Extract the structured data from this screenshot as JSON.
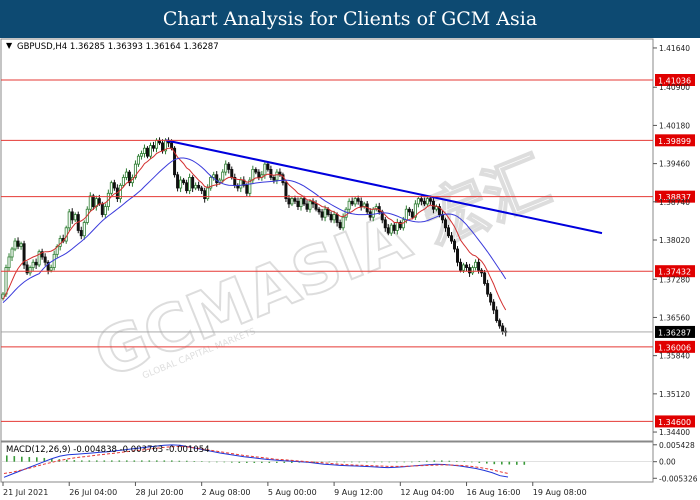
{
  "banner_title": "Chart Analysis for Clients of GCM Asia",
  "watermark": "GCMASIA 宏汇",
  "watermark_sub": "GLOBAL CAPITAL MARKETS",
  "colors": {
    "banner": "#0d4a72",
    "candle_up": "#2e7d32",
    "candle_down": "#111111",
    "sma_fast": "#d32f2f",
    "sma_slow": "#3a3adb",
    "trendline": "#0000dd",
    "level_line": "#e53935",
    "level_label_bg": "#e00000",
    "current_label_bg": "#000000",
    "macd_line": "#1f35d8",
    "signal_line": "#e53935",
    "histogram": "#3a9a3a"
  },
  "chart_data": [
    {
      "type": "candlestick",
      "symbol": "GBPUSD,H4",
      "ohlc_header": "GBPUSD,H4  1.36285 1.36393 1.36164 1.36287",
      "ohlc": {
        "open": 1.36285,
        "high": 1.36393,
        "low": 1.36164,
        "close": 1.36287
      },
      "ylim": [
        1.3425,
        1.4179
      ],
      "y_ticks": [
        "1.41640",
        "1.40900",
        "1.40180",
        "1.39460",
        "1.38740",
        "1.38020",
        "1.37280",
        "1.36560",
        "1.35840",
        "1.35120",
        "1.34400"
      ],
      "x_tick_labels": [
        "21 Jul 2021",
        "26 Jul 04:00",
        "28 Jul 20:00",
        "2 Aug 08:00",
        "5 Aug 00:00",
        "9 Aug 12:00",
        "12 Aug 04:00",
        "16 Aug 16:00",
        "19 Aug 08:00"
      ],
      "x_tick_index": [
        0,
        22,
        44,
        66,
        88,
        110,
        132,
        154,
        176
      ],
      "levels": [
        {
          "value": 1.41036,
          "label": "1.41036"
        },
        {
          "value": 1.39899,
          "label": "1.39899"
        },
        {
          "value": 1.38837,
          "label": "1.38837"
        },
        {
          "value": 1.37432,
          "label": "1.37432"
        },
        {
          "value": 1.36006,
          "label": "1.36006"
        },
        {
          "value": 1.346,
          "label": "1.34600"
        }
      ],
      "current_price": {
        "value": 1.36287,
        "label": "1.36287"
      },
      "trendline": [
        {
          "i": 54,
          "y": 1.399
        },
        {
          "i": 199,
          "y": 1.3815
        }
      ],
      "closes": [
        1.37,
        1.375,
        1.377,
        1.3785,
        1.38,
        1.379,
        1.3795,
        1.3755,
        1.374,
        1.375,
        1.376,
        1.3755,
        1.378,
        1.377,
        1.376,
        1.3745,
        1.375,
        1.3775,
        1.379,
        1.3805,
        1.38,
        1.3825,
        1.3855,
        1.384,
        1.385,
        1.382,
        1.381,
        1.3835,
        1.386,
        1.3885,
        1.3865,
        1.388,
        1.387,
        1.385,
        1.3865,
        1.389,
        1.391,
        1.39,
        1.388,
        1.3905,
        1.392,
        1.393,
        1.391,
        1.392,
        1.3945,
        1.396,
        1.3965,
        1.3975,
        1.396,
        1.398,
        1.3975,
        1.399,
        1.3985,
        1.397,
        1.399,
        1.3985,
        1.3975,
        1.3925,
        1.39,
        1.3915,
        1.391,
        1.3895,
        1.392,
        1.39,
        1.3905,
        1.39,
        1.3895,
        1.388,
        1.39,
        1.392,
        1.3925,
        1.391,
        1.3915,
        1.393,
        1.3945,
        1.3935,
        1.392,
        1.3905,
        1.39,
        1.3915,
        1.3905,
        1.389,
        1.3915,
        1.3935,
        1.393,
        1.392,
        1.3925,
        1.3945,
        1.3935,
        1.392,
        1.3915,
        1.393,
        1.3925,
        1.391,
        1.388,
        1.387,
        1.388,
        1.3875,
        1.3865,
        1.388,
        1.387,
        1.386,
        1.3875,
        1.387,
        1.386,
        1.3855,
        1.3845,
        1.386,
        1.385,
        1.384,
        1.385,
        1.3835,
        1.3825,
        1.3845,
        1.386,
        1.3875,
        1.387,
        1.388,
        1.3875,
        1.3865,
        1.387,
        1.3855,
        1.3845,
        1.386,
        1.3865,
        1.3855,
        1.384,
        1.3825,
        1.3815,
        1.383,
        1.382,
        1.3835,
        1.3825,
        1.384,
        1.386,
        1.3855,
        1.3845,
        1.387,
        1.388,
        1.3875,
        1.387,
        1.388,
        1.3875,
        1.386,
        1.3865,
        1.385,
        1.384,
        1.3825,
        1.381,
        1.38,
        1.3785,
        1.376,
        1.3745,
        1.3755,
        1.375,
        1.374,
        1.375,
        1.376,
        1.3745,
        1.374,
        1.372,
        1.37,
        1.3685,
        1.367,
        1.365,
        1.364,
        1.363,
        1.3628
      ],
      "sma_fast": [
        1.369,
        1.37,
        1.3712,
        1.3725,
        1.3738,
        1.3748,
        1.3756,
        1.3762,
        1.3764,
        1.3767,
        1.377,
        1.3772,
        1.3775,
        1.3778,
        1.378,
        1.378,
        1.3781,
        1.3784,
        1.3789,
        1.3795,
        1.38,
        1.3808,
        1.3818,
        1.3826,
        1.3833,
        1.3836,
        1.3838,
        1.3842,
        1.3848,
        1.3856,
        1.386,
        1.3866,
        1.387,
        1.387,
        1.3872,
        1.3877,
        1.3884,
        1.3889,
        1.3891,
        1.3896,
        1.3902,
        1.3909,
        1.3912,
        1.3916,
        1.3923,
        1.3931,
        1.3938,
        1.3946,
        1.395,
        1.3955,
        1.3959,
        1.3965,
        1.3968,
        1.397,
        1.3973,
        1.3975,
        1.3975,
        1.3967,
        1.3958,
        1.3952,
        1.3946,
        1.3938,
        1.3934,
        1.3927,
        1.3921,
        1.3915,
        1.391,
        1.3903,
        1.3901,
        1.3903,
        1.3905,
        1.3906,
        1.3908,
        1.3912,
        1.3917,
        1.392,
        1.392,
        1.3918,
        1.3916,
        1.3916,
        1.3915,
        1.3911,
        1.3912,
        1.3916,
        1.3919,
        1.3919,
        1.392,
        1.3924,
        1.3926,
        1.3925,
        1.3924,
        1.3925,
        1.3925,
        1.3922,
        1.3914,
        1.3906,
        1.3901,
        1.3896,
        1.389,
        1.3887,
        1.3883,
        1.3878,
        1.3877,
        1.3875,
        1.3872,
        1.3869,
        1.3865,
        1.3864,
        1.3861,
        1.3857,
        1.3855,
        1.3851,
        1.3847,
        1.3846,
        1.3849,
        1.3853,
        1.3856,
        1.386,
        1.3863,
        1.3864,
        1.3865,
        1.3863,
        1.386,
        1.386,
        1.3861,
        1.3859,
        1.3855,
        1.3849,
        1.3843,
        1.384,
        1.3835,
        1.3835,
        1.3833,
        1.3834,
        1.3838,
        1.3841,
        1.3842,
        1.3847,
        1.3853,
        1.3857,
        1.386,
        1.3865,
        1.3868,
        1.3866,
        1.3866,
        1.3863,
        1.3858,
        1.3852,
        1.3844,
        1.3836,
        1.3827,
        1.3815,
        1.3802,
        1.3794,
        1.3787,
        1.3779,
        1.3774,
        1.3772,
        1.3767,
        1.3762,
        1.3754,
        1.3743,
        1.3731,
        1.3719,
        1.3705,
        1.3692,
        1.368,
        1.367
      ]
    },
    {
      "type": "macd",
      "label": "MACD(12,26,9) -0.004838 -0.003763 -0.001054",
      "ylim": [
        -0.0062,
        0.006
      ],
      "y_ticks": [
        {
          "label": "0.005428",
          "v": 0.005428
        },
        {
          "label": "0.00",
          "v": 0
        },
        {
          "label": "-0.005326",
          "v": -0.005326
        }
      ],
      "macd": [
        -0.005,
        -0.004,
        -0.003,
        -0.002,
        -0.001,
        0.0,
        0.001,
        0.0018,
        0.0022,
        0.0024,
        0.0026,
        0.0028,
        0.003,
        0.0032,
        0.0035,
        0.0038,
        0.0041,
        0.0044,
        0.0047,
        0.005,
        0.0053,
        0.0054,
        0.0053,
        0.0048,
        0.0043,
        0.0038,
        0.0033,
        0.0028,
        0.0024,
        0.002,
        0.0016,
        0.0013,
        0.001,
        0.0007,
        0.0005,
        0.0003,
        0.0002,
        0.0,
        -0.0002,
        -0.0005,
        -0.0008,
        -0.001,
        -0.0012,
        -0.0013,
        -0.0014,
        -0.0015,
        -0.0016,
        -0.0018,
        -0.0019,
        -0.0018,
        -0.0016,
        -0.0014,
        -0.0012,
        -0.001,
        -0.0008,
        -0.0009,
        -0.0011,
        -0.0014,
        -0.0018,
        -0.0022,
        -0.0028,
        -0.0035,
        -0.0045,
        -0.0049
      ],
      "signal": [
        -0.0038,
        -0.0034,
        -0.0028,
        -0.0022,
        -0.0015,
        -0.0008,
        -0.0002,
        0.0004,
        0.0009,
        0.0013,
        0.0016,
        0.0019,
        0.0022,
        0.0025,
        0.0028,
        0.0031,
        0.0034,
        0.0037,
        0.004,
        0.0043,
        0.0046,
        0.0048,
        0.0049,
        0.0047,
        0.0044,
        0.004,
        0.0036,
        0.0032,
        0.0028,
        0.0024,
        0.002,
        0.0017,
        0.0014,
        0.0011,
        0.0008,
        0.0006,
        0.0004,
        0.0002,
        0.0,
        -0.0002,
        -0.0004,
        -0.0006,
        -0.0008,
        -0.001,
        -0.0011,
        -0.0012,
        -0.0013,
        -0.0014,
        -0.0015,
        -0.0015,
        -0.0015,
        -0.0014,
        -0.0013,
        -0.0012,
        -0.0011,
        -0.001,
        -0.0011,
        -0.0012,
        -0.0014,
        -0.0017,
        -0.0021,
        -0.0026,
        -0.0032,
        -0.0038
      ],
      "histogram": [
        0.002,
        0.0018,
        0.0016,
        0.0015,
        0.0014,
        0.0012,
        0.001,
        0.0008,
        0.0006,
        0.0005,
        0.0004,
        0.0004,
        0.0004,
        0.0004,
        0.0004,
        0.0004,
        0.0004,
        0.0004,
        0.0004,
        0.0004,
        0.0004,
        0.0004,
        0.0004,
        0.0003,
        0.0003,
        0.0002,
        0.0001,
        0.0,
        -0.0001,
        -0.0002,
        -0.0003,
        -0.0004,
        -0.0004,
        -0.0004,
        -0.0004,
        -0.0004,
        -0.0004,
        -0.0004,
        -0.0004,
        -0.0003,
        -0.0003,
        -0.0003,
        -0.0002,
        -0.0002,
        -0.0002,
        -0.0002,
        -0.0002,
        -0.0002,
        -0.0002,
        -0.0001,
        -0.0001,
        -0.0002,
        -0.0002,
        -0.0001,
        0.0,
        0.0002,
        0.0003,
        0.0004,
        0.0004,
        0.0003,
        0.0002,
        0.0001,
        -0.0002,
        -0.0004,
        -0.0006,
        -0.0008,
        -0.0009,
        -0.0009,
        -0.001,
        -0.001
      ]
    }
  ]
}
